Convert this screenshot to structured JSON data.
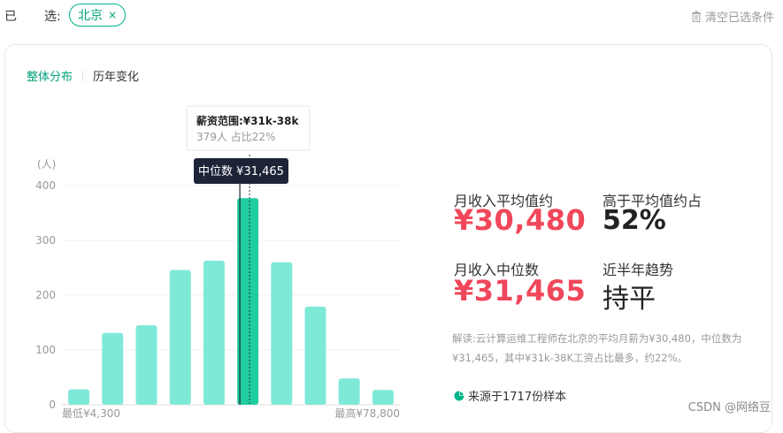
{
  "filter": {
    "label_first": "已",
    "label_second": "选:",
    "chip_label": "北京",
    "chip_close": "×",
    "clear_label": "清空已选条件"
  },
  "tabs": [
    {
      "label": "整体分布",
      "active": true
    },
    {
      "label": "历年变化",
      "active": false
    }
  ],
  "chart_data": {
    "type": "bar",
    "ylabel": "(人)",
    "ylim": [
      0,
      450
    ],
    "yticks": [
      0,
      100,
      200,
      300,
      400
    ],
    "values": [
      28,
      131,
      145,
      246,
      263,
      377,
      260,
      179,
      48,
      27
    ],
    "highlight_index": 5,
    "x_start_label": "最低¥4,300",
    "x_end_label": "最高¥78,800",
    "tooltip": {
      "title": "薪资范围:¥31k-38k",
      "detail": "379人  占比22%"
    },
    "median_label": "中位数 ¥31,465",
    "colors": {
      "bar": "#7fe9d8",
      "highlight": "#1fcd9f",
      "median": "#1d2438"
    }
  },
  "stats": {
    "avg_label": "月收入平均值约",
    "avg_value": "¥30,480",
    "above_avg_label": "高于平均值约占",
    "above_avg_value": "52%",
    "median_label": "月收入中位数",
    "median_value": "¥31,465",
    "trend_label": "近半年趋势",
    "trend_value": "持平"
  },
  "interpretation": "解读:云计算运维工程师在北京的平均月薪为¥30,480，中位数为¥31,465，其中¥31k-38K工资占比最多，约22%。",
  "source": "来源于1717份样本",
  "watermark": "CSDN @网络豆"
}
